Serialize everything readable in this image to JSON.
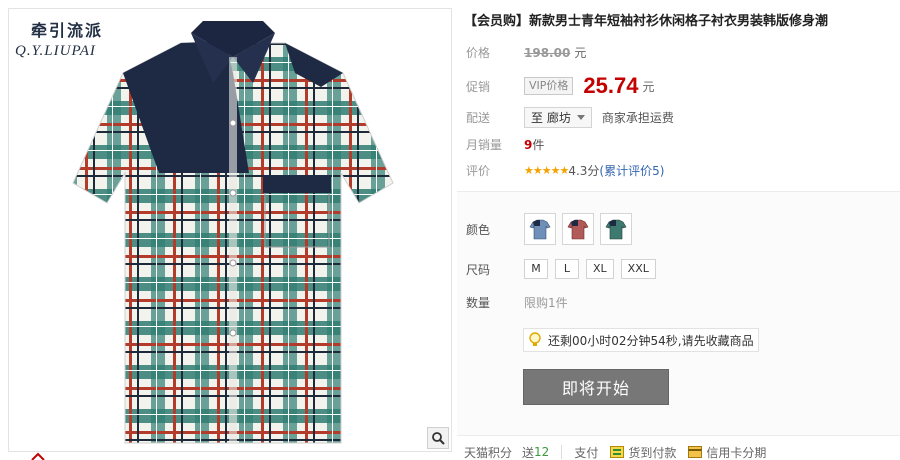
{
  "brand": {
    "name_cn": "牵引流派",
    "name_en": "Q.Y.LIUPAI"
  },
  "product": {
    "title": "【会员购】新款男士青年短袖衬衫休闲格子衬衣男装韩版修身潮"
  },
  "price": {
    "label": "价格",
    "original": "198.00",
    "unit": "元"
  },
  "promo": {
    "label": "促销",
    "badge": "VIP价格",
    "price": "25.74",
    "unit": "元"
  },
  "shipping": {
    "label": "配送",
    "selected": "至 廊坊",
    "note": "商家承担运费"
  },
  "sales": {
    "label": "月销量",
    "count": "9",
    "unit": "件"
  },
  "rating": {
    "label": "评价",
    "stars": "★★★★★",
    "score": "4.3分",
    "reviews_link": "(累计评价5)"
  },
  "options": {
    "color_label": "颜色",
    "size_label": "尺码",
    "sizes": [
      "M",
      "L",
      "XL",
      "XXL"
    ],
    "quantity_label": "数量",
    "limit_text": "限购1件"
  },
  "countdown": {
    "text": "还剩00小时02分钟54秒,请先收藏商品"
  },
  "action": {
    "start_button": "即将开始"
  },
  "bottom": {
    "points_label": "天猫积分",
    "points_prefix": "送",
    "points_value": "12",
    "pay_label": "支付",
    "cod": "货到付款",
    "installment": "信用卡分期"
  },
  "icons": {
    "zoom": "magnifier-icon",
    "bulb": "lightbulb-icon",
    "cod": "cod-icon",
    "card": "credit-card-icon"
  },
  "colors": {
    "price_red": "#c40000",
    "star_orange": "#f5a200",
    "link_blue": "#3466b2",
    "points_green": "#3a9b3a",
    "button_gray": "#777777"
  }
}
